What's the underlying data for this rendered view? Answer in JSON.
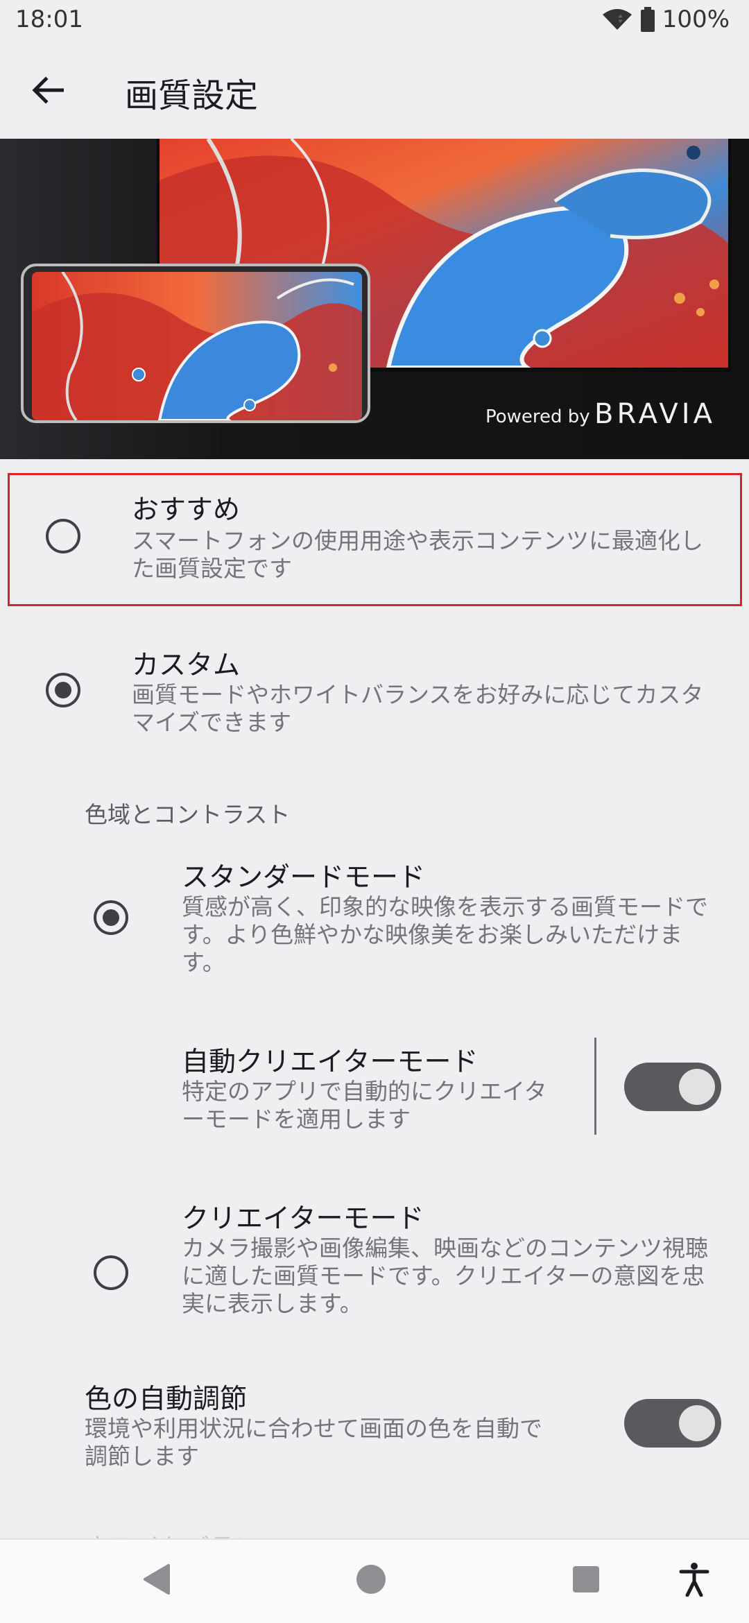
{
  "status_bar": {
    "time": "18:01",
    "battery": "100%",
    "wifi_icon": "wifi-icon",
    "battery_icon": "battery-icon"
  },
  "app_bar": {
    "title": "画質設定",
    "back_icon": "arrow-back-icon"
  },
  "hero": {
    "powered_by": "Powered by",
    "brand": "BRAVIA"
  },
  "options": {
    "recommended": {
      "title": "おすすめ",
      "summary": "スマートフォンの使用用途や表示コンテンツに最適化した画質設定です",
      "selected": false
    },
    "custom": {
      "title": "カスタム",
      "summary": "画質モードやホワイトバランスをお好みに応じてカスタマイズできます",
      "selected": true
    }
  },
  "section": {
    "gamut_contrast": "色域とコントラスト"
  },
  "modes": {
    "standard": {
      "title": "スタンダードモード",
      "summary": "質感が高く、印象的な映像を表示する画質モードです。より色鮮やかな映像美をお楽しみいただけます。",
      "selected": true
    },
    "auto_creator": {
      "title": "自動クリエイターモード",
      "summary": "特定のアプリで自動的にクリエイターモードを適用します",
      "enabled": true
    },
    "creator": {
      "title": "クリエイターモード",
      "summary": "カメラ撮影や画像編集、映画などのコンテンツ視聴に適した画質モードです。クリエイターの意図を忠実に表示します。",
      "selected": false
    }
  },
  "auto_color": {
    "title": "色の自動調節",
    "summary": "環境や利用状況に合わせて画面の色を自動で調節します",
    "enabled": true
  },
  "next_section_partial": "ホワイトバランス",
  "nav_bar": {
    "back": "nav-back-icon",
    "home": "nav-home-icon",
    "recents": "nav-recents-icon",
    "accessibility": "accessibility-icon"
  },
  "colors": {
    "background": "#efeff2",
    "highlight": "#d8232a",
    "toggle_on": "#5a5a5e"
  }
}
